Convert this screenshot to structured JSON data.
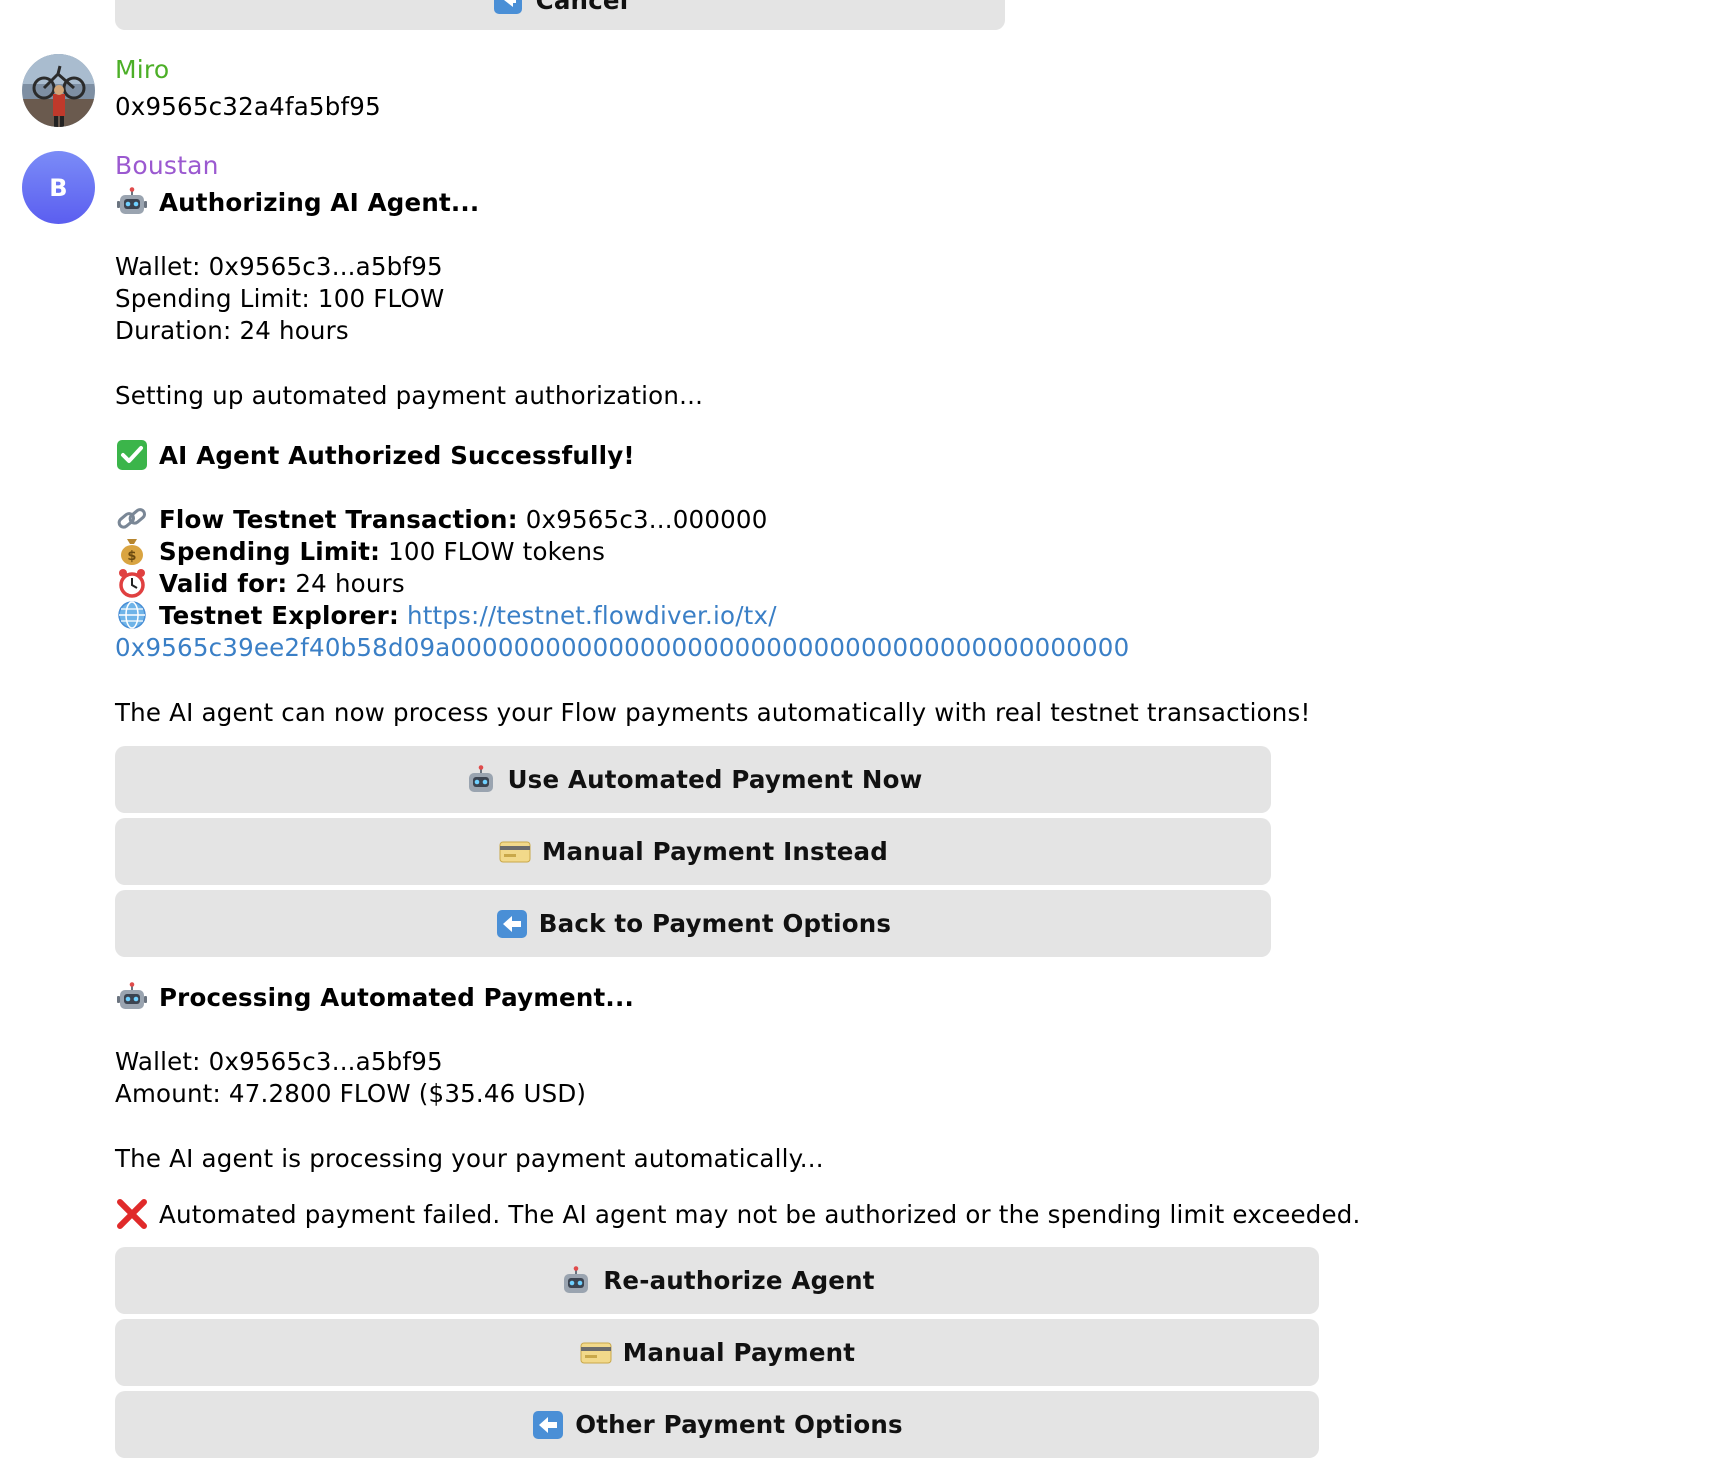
{
  "top_button": {
    "label": "Cancel",
    "icon": "back-arrow-icon"
  },
  "miro": {
    "name": "Miro",
    "name_color": "#4caf27",
    "message": "0x9565c32a4fa5bf95"
  },
  "boustan": {
    "name": "Boustan",
    "name_color": "#9b59d0",
    "avatar_initial": "B"
  },
  "authorizing": {
    "title": "Authorizing AI Agent...",
    "wallet": "Wallet: 0x9565c3...a5bf95",
    "spending_limit": "Spending Limit: 100 FLOW",
    "duration": "Duration: 24 hours",
    "setting_up": "Setting up automated payment authorization..."
  },
  "authorized": {
    "title": "AI Agent Authorized Successfully!",
    "tx_label": "Flow Testnet Transaction:",
    "tx_value": "0x9565c3...000000",
    "limit_label": "Spending Limit:",
    "limit_value": "100 FLOW tokens",
    "valid_label": "Valid for:",
    "valid_value": "24 hours",
    "explorer_label": "Testnet Explorer:",
    "explorer_url_line1": "https://testnet.flowdiver.io/tx/",
    "explorer_url_line2": "0x9565c39ee2f40b58d09a0000000000000000000000000000000000000000000",
    "summary": "The AI agent can now process your Flow payments automatically with real testnet transactions!"
  },
  "buttons_group1": {
    "use_automated": "Use Automated Payment Now",
    "manual_instead": "Manual Payment Instead",
    "back_to_options": "Back to Payment Options"
  },
  "processing": {
    "title": "Processing Automated Payment...",
    "wallet": "Wallet: 0x9565c3...a5bf95",
    "amount": "Amount: 47.2800 FLOW ($35.46 USD)",
    "status": "The AI agent is processing your payment automatically...",
    "error": "Automated payment failed. The AI agent may not be authorized or the spending limit exceeded."
  },
  "buttons_group2": {
    "reauthorize": "Re-authorize Agent",
    "manual": "Manual Payment",
    "other_options": "Other Payment Options"
  },
  "colors": {
    "button_bg": "#e4e4e4",
    "link": "#3a7fc6",
    "success_green": "#3bb54a",
    "error_red": "#e02a2a"
  }
}
